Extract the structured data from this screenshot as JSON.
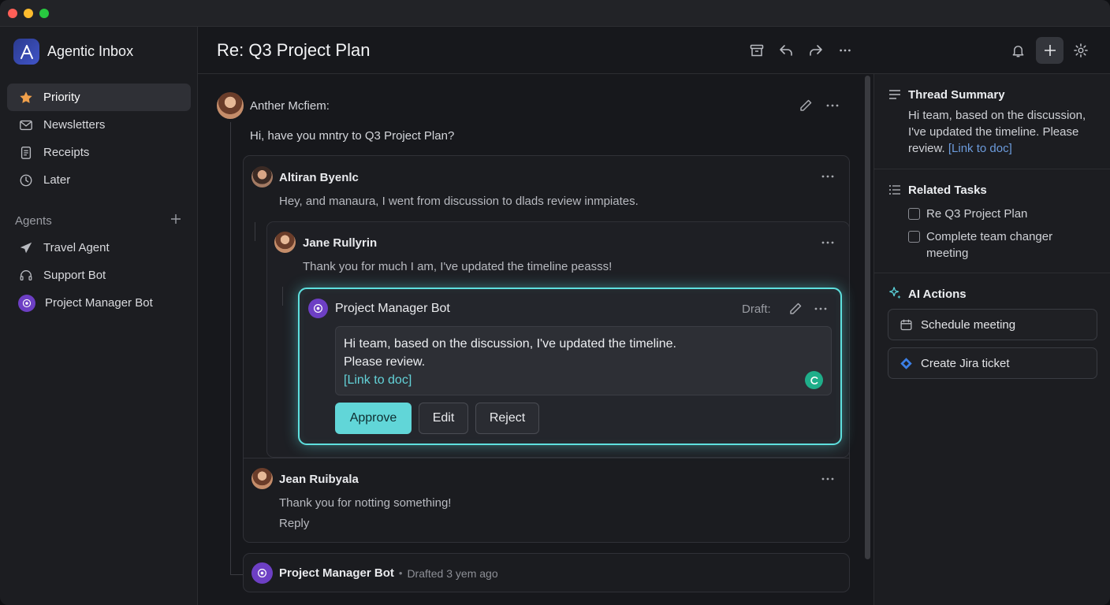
{
  "app": {
    "title": "Agentic Inbox"
  },
  "sidebar": {
    "items": [
      {
        "label": "Priority",
        "icon": "star-icon",
        "active": true
      },
      {
        "label": "Newsletters",
        "icon": "mail-icon"
      },
      {
        "label": "Receipts",
        "icon": "receipt-icon"
      },
      {
        "label": "Later",
        "icon": "clock-icon"
      }
    ],
    "agents_heading": "Agents",
    "agents": [
      {
        "label": "Travel Agent",
        "icon": "plane-icon"
      },
      {
        "label": "Support Bot",
        "icon": "headset-icon"
      },
      {
        "label": "Project Manager Bot",
        "icon": "bot-icon"
      }
    ]
  },
  "header": {
    "subject": "Re: Q3 Project Plan"
  },
  "thread": {
    "m1": {
      "sender": "Anther Mcfiem:",
      "text": "Hi, have you mntry to Q3 Project Plan?"
    },
    "m2": {
      "sender": "Altiran Byenlc",
      "text": "Hey, and manaura, I went from  discussion to dlads review inmpiates."
    },
    "m3": {
      "sender": "Jane Rullyrin",
      "text": "Thank you for much I am, I've updated the timeline peasss!"
    },
    "draft": {
      "sender": "Project Manager Bot",
      "status": "Draft:",
      "line1": "Hi team, based on the discussion, I've updated the timeline.",
      "line2": "Please review.",
      "link": "[Link to doc]",
      "approve": "Approve",
      "edit": "Edit",
      "reject": "Reject"
    },
    "m4": {
      "sender": "Jean Ruibyala",
      "text": "Thank you for notting something!",
      "reply": "Reply"
    },
    "m5": {
      "sender": "Project Manager Bot",
      "meta": "Drafted 3 yem ago"
    }
  },
  "rpanel": {
    "summary": {
      "title": "Thread Summary",
      "line1": "Hi team, based on the discussion,",
      "line2": "I've updated the timeline. Please",
      "line3": "review.",
      "link": "[Link to doc]"
    },
    "tasks": {
      "title": "Related Tasks",
      "items": [
        {
          "label": "Re Q3 Project Plan"
        },
        {
          "label": "Complete team changer",
          "label2": "meeting"
        }
      ]
    },
    "ai": {
      "title": "AI Actions",
      "actions": [
        {
          "label": "Schedule meeting",
          "icon": "calendar-icon"
        },
        {
          "label": "Create Jira ticket",
          "icon": "jira-icon"
        }
      ]
    }
  },
  "colors": {
    "accent": "#5ee0df",
    "bot": "#6d3fc4",
    "link": "#6c9bdc"
  }
}
